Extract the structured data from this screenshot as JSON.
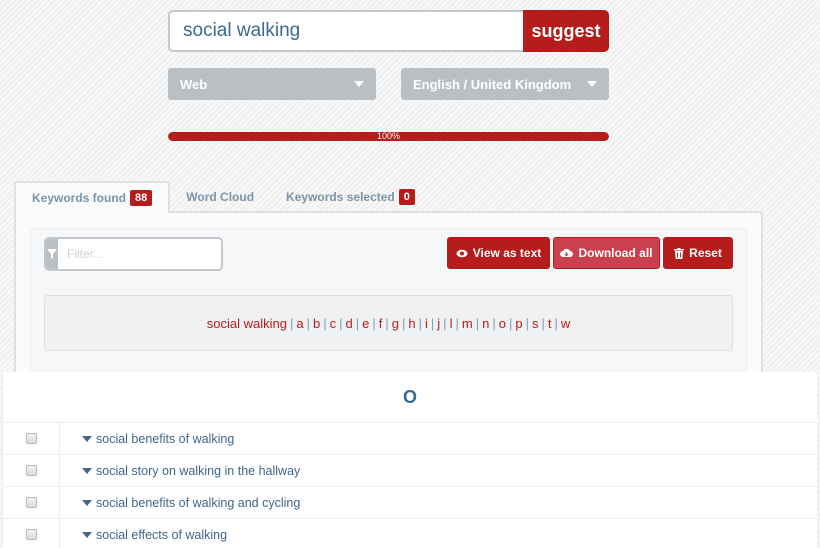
{
  "search": {
    "value": "social walking",
    "button_label": "suggest"
  },
  "selects": {
    "source": "Web",
    "language": "English / United Kingdom"
  },
  "progress": {
    "percent": 100,
    "label": "100%"
  },
  "tabs": [
    {
      "label": "Keywords found",
      "badge": "88",
      "active": true
    },
    {
      "label": "Word Cloud"
    },
    {
      "label": "Keywords selected",
      "badge": "0"
    }
  ],
  "filter": {
    "placeholder": "Filter..."
  },
  "actions": {
    "view_as_text": "View as text",
    "download_all": "Download all",
    "reset": "Reset"
  },
  "letters": [
    "social walking",
    "a",
    "b",
    "c",
    "d",
    "e",
    "f",
    "g",
    "h",
    "i",
    "j",
    "l",
    "m",
    "n",
    "o",
    "p",
    "s",
    "t",
    "w"
  ],
  "list": {
    "header": "O",
    "rows": [
      "social benefits of walking",
      "social story on walking in the hallway",
      "social benefits of walking and cycling",
      "social effects of walking"
    ]
  },
  "colors": {
    "accent": "#b71c1c",
    "link": "#3d6790",
    "select_bg": "#babfc4"
  }
}
